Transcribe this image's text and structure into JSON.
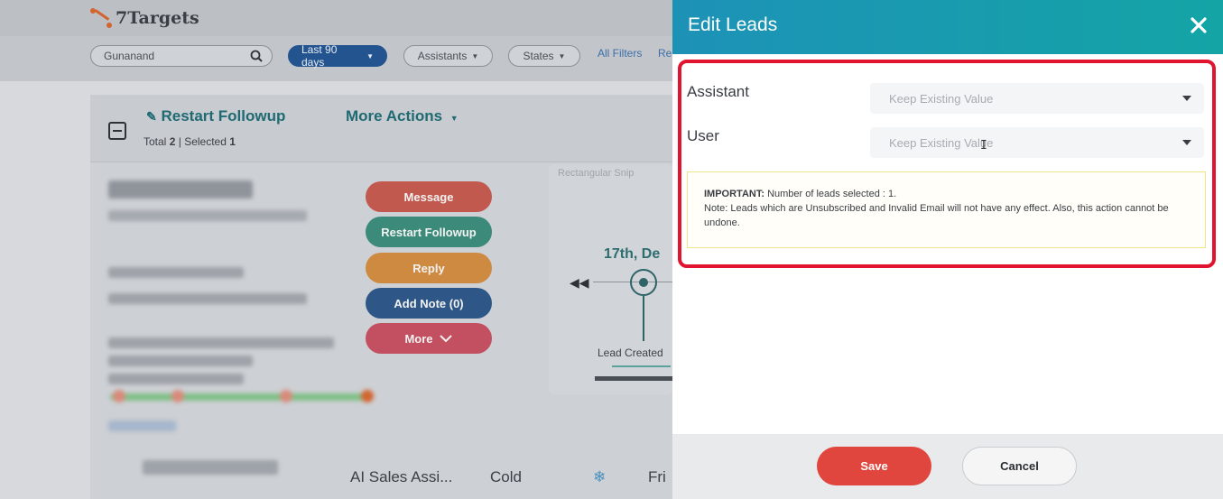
{
  "app": {
    "logo_text": "7Targets",
    "search_value": "Gunanand",
    "filters": {
      "date_range": "Last 90 days",
      "assistants": "Assistants",
      "states": "States",
      "all_filters": "All Filters",
      "reset_partial": "Re"
    },
    "list_header": {
      "restart_followup": "Restart Followup",
      "more_actions": "More Actions",
      "total_label": "Total",
      "total_count": "2",
      "selected_label": "Selected",
      "selected_count": "1"
    },
    "lead_actions": {
      "message": "Message",
      "restart_followup": "Restart Followup",
      "reply": "Reply",
      "add_note": "Add Note (0)",
      "more": "More"
    },
    "timeline": {
      "snip_label": "Rectangular Snip",
      "date": "17th, De",
      "lead_created": "Lead Created"
    },
    "second_row": {
      "assistant": "AI Sales Assi...",
      "state": "Cold",
      "day": "Fri"
    }
  },
  "modal": {
    "title": "Edit Leads",
    "fields": [
      {
        "label": "Assistant",
        "value": "Keep Existing Value"
      },
      {
        "label": "User",
        "value": "Keep Existing Value"
      }
    ],
    "important_label": "IMPORTANT:",
    "important_text": "Number of leads selected : 1.",
    "note_text": "Note: Leads which are Unsubscribed and Invalid Email will not have any effect. Also, this action cannot be undone.",
    "save_label": "Save",
    "cancel_label": "Cancel"
  },
  "colors": {
    "header_gradient_start": "#1d92b7",
    "header_gradient_end": "#14a4a6",
    "highlight_border": "#e0142f",
    "save_button": "#e0463d",
    "note_border": "#f0e58a"
  },
  "icons": [
    "search-icon",
    "pencil-icon",
    "chevron-down-icon",
    "close-icon",
    "rewind-icon",
    "collapse-icon",
    "snowflake-icon"
  ]
}
